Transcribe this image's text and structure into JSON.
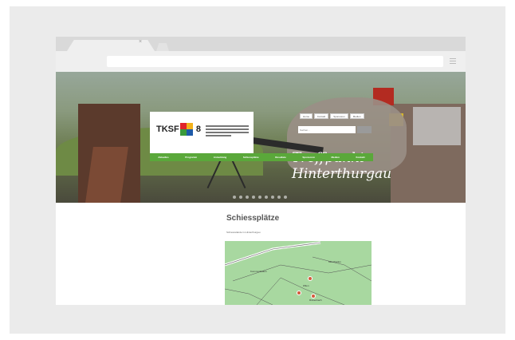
{
  "site": {
    "logo_text": "TKSF 2",
    "logo_suffix": "8",
    "top_links": [
      "Home",
      "Kontakt",
      "Sponsoren",
      "Medien"
    ],
    "search_placeholder": "Suchen...",
    "nav_items": [
      "Aktuelles",
      "Programm",
      "Anmeldung",
      "Schiessplätze",
      "Resultate",
      "Sponsoren",
      "Medien",
      "Kontakt"
    ],
    "hero_script_line1": "Treffpunkt",
    "hero_script_line2": "Hinterthurgau"
  },
  "content": {
    "title": "Schiessplätze",
    "subtitle": "Schiessstände im Hinterthurgau",
    "map_labels": [
      "Kommunikation",
      "Münchwilen",
      "Wilen",
      "Rickenbach"
    ]
  },
  "colors": {
    "nav_green": "#5aa83a",
    "accent_red": "#b32b21",
    "map_green": "#a8d8a0"
  }
}
